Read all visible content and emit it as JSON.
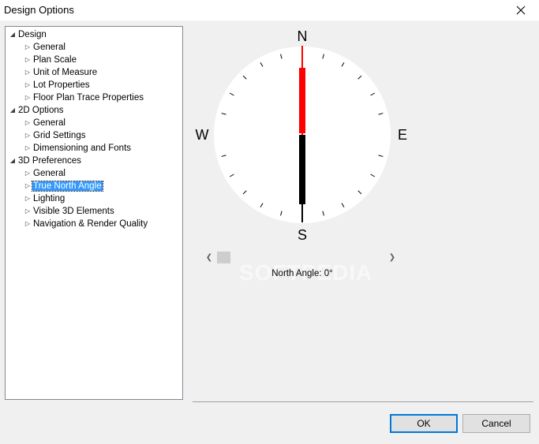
{
  "window": {
    "title": "Design Options"
  },
  "tree": {
    "items": [
      {
        "label": "Design",
        "expanded": true,
        "level": 0
      },
      {
        "label": "General",
        "level": 1
      },
      {
        "label": "Plan Scale",
        "level": 1
      },
      {
        "label": "Unit of Measure",
        "level": 1
      },
      {
        "label": "Lot Properties",
        "level": 1
      },
      {
        "label": "Floor Plan Trace Properties",
        "level": 1
      },
      {
        "label": "2D Options",
        "expanded": true,
        "level": 0
      },
      {
        "label": "General",
        "level": 1
      },
      {
        "label": "Grid Settings",
        "level": 1
      },
      {
        "label": "Dimensioning and Fonts",
        "level": 1
      },
      {
        "label": "3D Preferences",
        "expanded": true,
        "level": 0
      },
      {
        "label": "General",
        "level": 1
      },
      {
        "label": "True North Angle",
        "level": 1,
        "selected": true
      },
      {
        "label": "Lighting",
        "level": 1
      },
      {
        "label": "Visible 3D Elements",
        "level": 1
      },
      {
        "label": "Navigation & Render Quality",
        "level": 1
      }
    ]
  },
  "compass": {
    "north": "N",
    "south": "S",
    "east": "E",
    "west": "W",
    "angle_degrees": 0,
    "north_color": "#ff0000",
    "south_color": "#000000"
  },
  "angle_slider": {
    "value_fraction": 0
  },
  "north_angle_label": "North Angle: 0°",
  "watermark": "SOFTPEDIA",
  "buttons": {
    "ok": "OK",
    "cancel": "Cancel"
  },
  "colors": {
    "selection": "#3399ff",
    "default_button_border": "#0078d7"
  }
}
